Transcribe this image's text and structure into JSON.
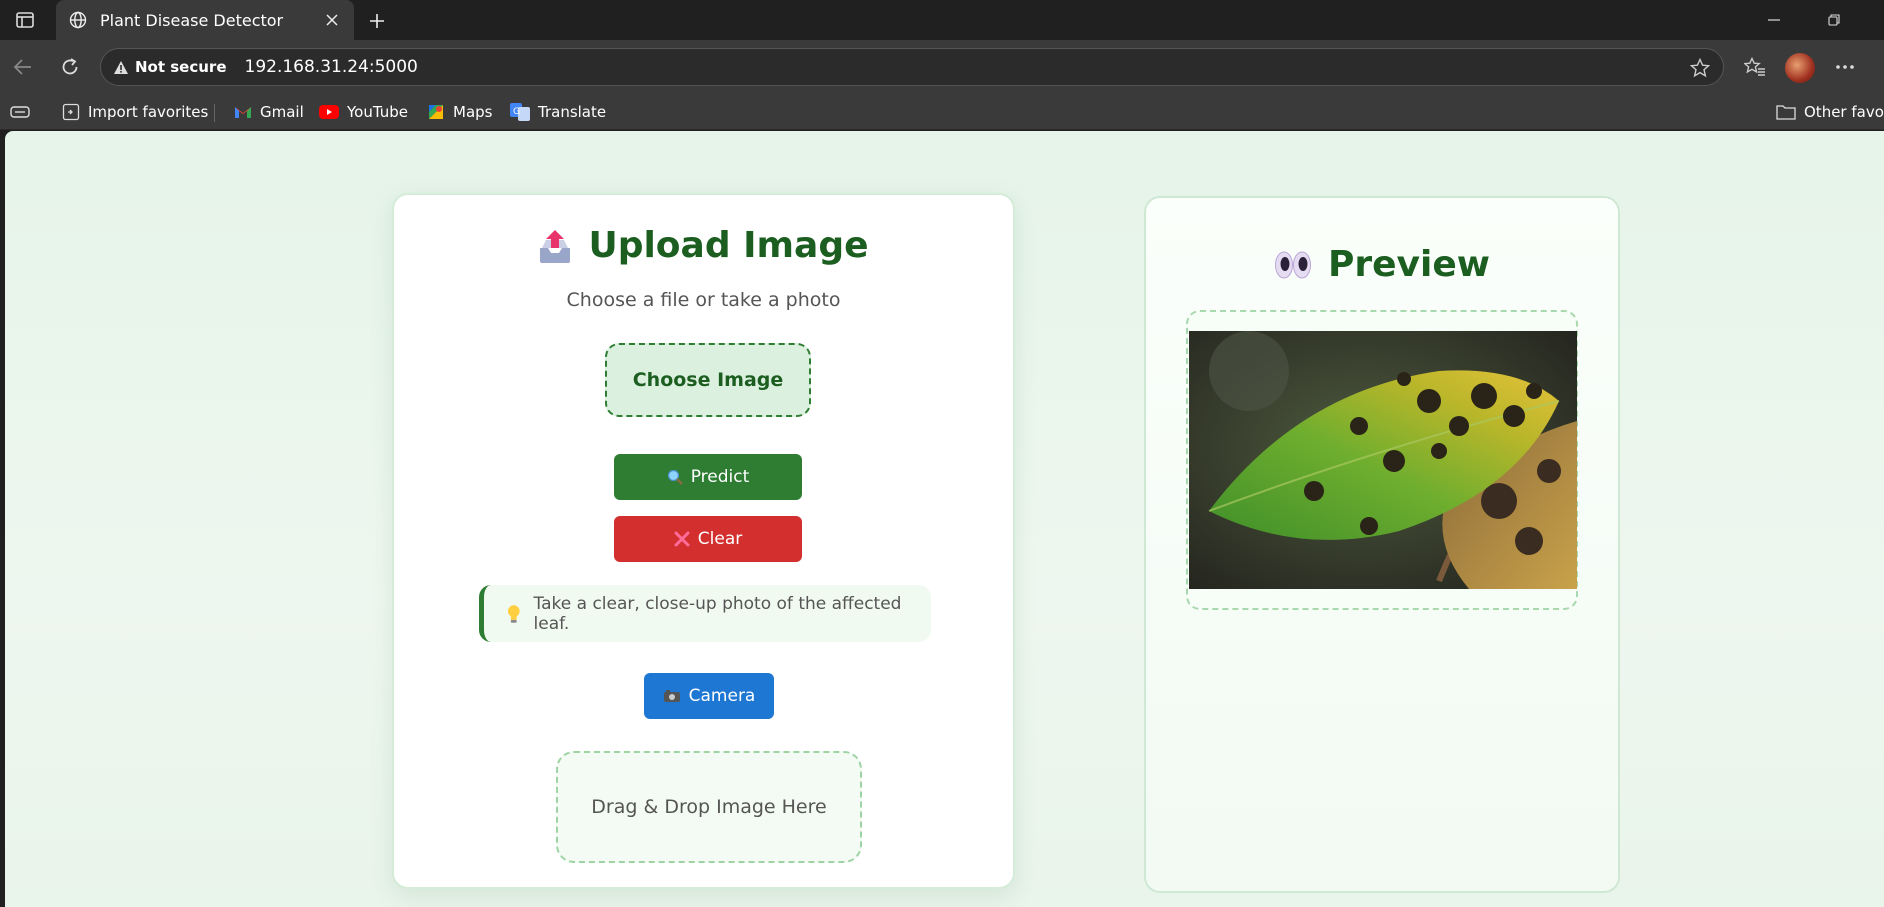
{
  "browser": {
    "tab_title": "Plant Disease Detector",
    "security_label": "Not secure",
    "url": "192.168.31.24:5000",
    "bookmarks": [
      "Import favorites",
      "Gmail",
      "YouTube",
      "Maps",
      "Translate"
    ],
    "other_favorites": "Other favorites"
  },
  "upload": {
    "title": "Upload Image",
    "subtitle": "Choose a file or take a photo",
    "choose_label": "Choose Image",
    "predict_label": "Predict",
    "clear_label": "Clear",
    "tip_text": "Take a clear, close-up photo of the affected leaf.",
    "camera_label": "Camera",
    "drop_text": "Drag & Drop Image Here"
  },
  "preview": {
    "title": "Preview",
    "image_icon": "leaf-disease-photo"
  },
  "colors": {
    "primary_green": "#2e7d32",
    "title_green": "#1b5e20",
    "clear_red": "#d32f2f",
    "camera_blue": "#1e77d2"
  }
}
